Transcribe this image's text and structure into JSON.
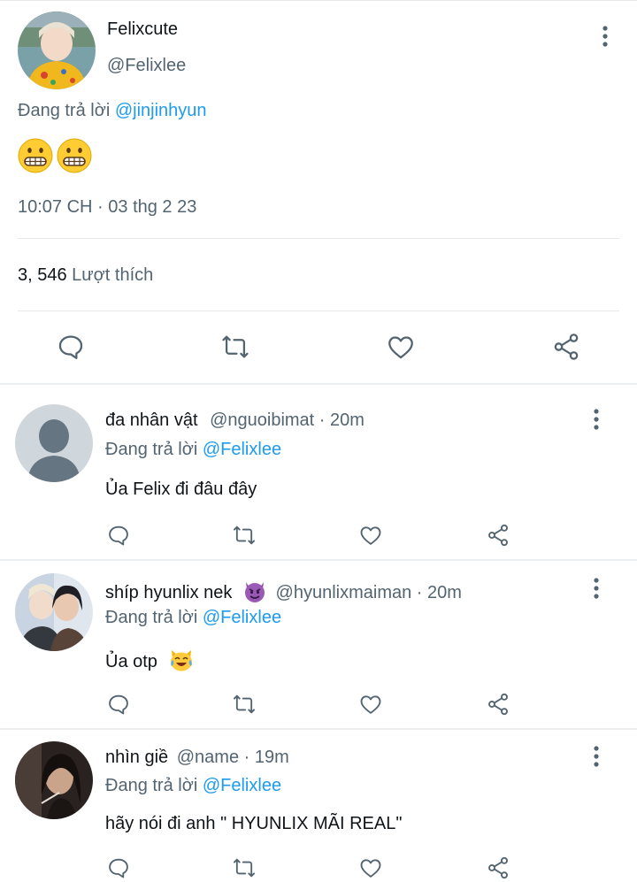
{
  "main_tweet": {
    "display_name": "Felixcute",
    "handle": "@Felixlee",
    "reply_prefix": "Đang trả lời",
    "reply_to": "@jinjinhyun",
    "content_emoji": [
      "grimacing-face",
      "grimacing-face"
    ],
    "timestamp": "10:07 CH · 03 thg 2 23",
    "likes_count": "3, 546",
    "likes_label": "Lượt thích"
  },
  "replies": [
    {
      "display_name": "đa nhân vật",
      "handle_time": "@nguoibimat · 20m",
      "reply_prefix": "Đang trả lời",
      "reply_to": "@Felixlee",
      "text": "Ủa Felix đi đâu đây"
    },
    {
      "display_name": "shíp hyunlix nek",
      "name_emoji": "smiling-face-with-horns",
      "handle_time": "@hyunlixmaiman · 20m",
      "reply_prefix": "Đang trả lời",
      "reply_to": "@Felixlee",
      "text": "Ủa otp",
      "text_emoji": "cat-with-tears-of-joy"
    },
    {
      "display_name": "nhìn giề",
      "handle_time": "@name · 19m",
      "reply_prefix": "Đang trả lời",
      "reply_to": "@Felixlee",
      "text": "hãy nói đi anh \" HYUNLIX MÃI REAL\""
    }
  ],
  "colors": {
    "link": "#1d9bf0",
    "secondary": "#536471",
    "icon": "#536471",
    "divider": "#e6e9ec"
  }
}
